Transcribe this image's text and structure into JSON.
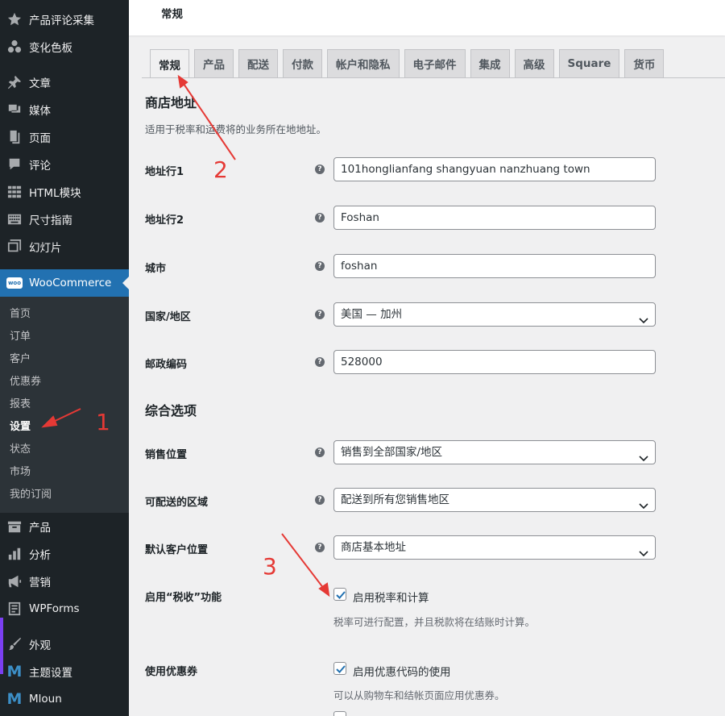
{
  "sidebar": {
    "items_top": [
      {
        "label": "产品评论采集",
        "icon": "star-icon"
      },
      {
        "label": "变化色板",
        "icon": "swatches-icon"
      }
    ],
    "items_mid": [
      {
        "label": "文章",
        "icon": "pin-icon"
      },
      {
        "label": "媒体",
        "icon": "media-icon"
      },
      {
        "label": "页面",
        "icon": "page-icon"
      },
      {
        "label": "评论",
        "icon": "comment-icon"
      },
      {
        "label": "HTML模块",
        "icon": "grid-icon"
      },
      {
        "label": "尺寸指南",
        "icon": "keyboard-icon"
      },
      {
        "label": "幻灯片",
        "icon": "slides-icon"
      }
    ],
    "woo": {
      "label": "WooCommerce",
      "badge": "woo"
    },
    "submenu": [
      "首页",
      "订单",
      "客户",
      "优惠券",
      "报表",
      "设置",
      "状态",
      "市场",
      "我的订阅"
    ],
    "submenu_current": "设置",
    "items_bottom": [
      {
        "label": "产品",
        "icon": "archive-icon"
      },
      {
        "label": "分析",
        "icon": "bar-chart-icon"
      },
      {
        "label": "营销",
        "icon": "megaphone-icon"
      },
      {
        "label": "WPForms",
        "icon": "forms-icon"
      }
    ],
    "items_last": [
      {
        "label": "外观",
        "icon": "brush-icon"
      },
      {
        "label": "主题设置",
        "icon": "m-logo-icon"
      },
      {
        "label": "Mloun",
        "icon": "m-logo-icon"
      }
    ],
    "m_logo_text": "M"
  },
  "header": {
    "title": "常规"
  },
  "tabs": [
    "常规",
    "产品",
    "配送",
    "付款",
    "帐户和隐私",
    "电子邮件",
    "集成",
    "高级",
    "Square",
    "货币"
  ],
  "active_tab": "常规",
  "store_address": {
    "title": "商店地址",
    "desc": "适用于税率和运费将的业务所在地地址。",
    "fields": [
      {
        "label": "地址行1",
        "value": "101honglianfang shangyuan nanzhuang town"
      },
      {
        "label": "地址行2",
        "value": "Foshan"
      },
      {
        "label": "城市",
        "value": "foshan"
      },
      {
        "label": "国家/地区",
        "value": "美国 — 加州"
      },
      {
        "label": "邮政编码",
        "value": "528000"
      }
    ]
  },
  "general_options": {
    "title": "综合选项",
    "selling_location": {
      "label": "销售位置",
      "value": "销售到全部国家/地区"
    },
    "ship_to": {
      "label": "可配送的区域",
      "value": "配送到所有您销售地区"
    },
    "default_customer": {
      "label": "默认客户位置",
      "value": "商店基本地址"
    },
    "taxes": {
      "label": "启用“税收”功能",
      "checkbox_label": "启用税率和计算",
      "desc": "税率可进行配置，并且税款将在结账时计算。",
      "checked": true
    },
    "coupons": {
      "label": "使用优惠券",
      "checkbox_label": "启用优惠代码的使用",
      "desc": "可以从购物车和结帐页面应用优惠券。",
      "checked": true
    }
  },
  "help_glyph": "?",
  "annotations": {
    "color": "#e53935",
    "numbers": [
      "1",
      "2",
      "3"
    ]
  },
  "colors": {
    "sidebar_bg": "#1d2327",
    "submenu_bg": "#2c3338",
    "accent": "#2271b1",
    "checkbox": "#2271b1"
  }
}
